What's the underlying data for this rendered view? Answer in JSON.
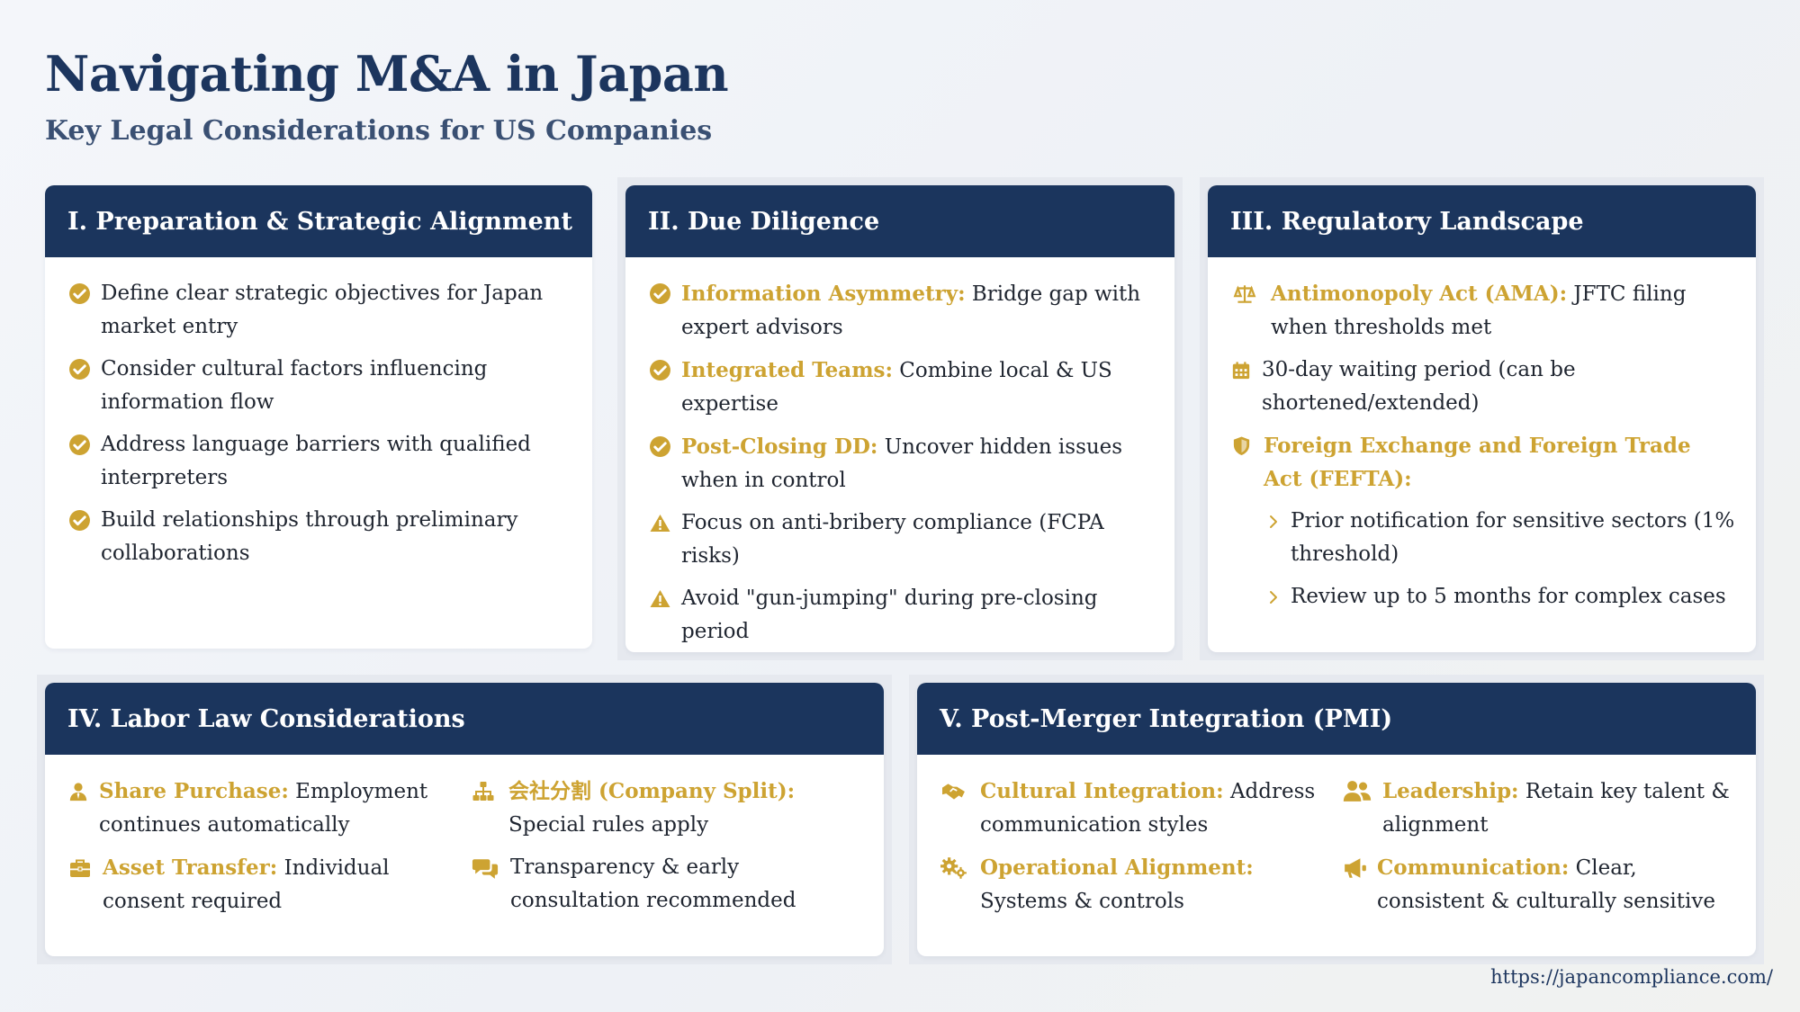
{
  "header": {
    "title": "Navigating M&A in Japan",
    "subtitle": "Key Legal Considerations for US Companies"
  },
  "colors": {
    "navy": "#1b355d",
    "gold": "#cda332",
    "text": "#1f2530"
  },
  "sections": {
    "preparation": {
      "title": "I. Preparation & Strategic Alignment",
      "items": [
        {
          "icon": "check-circle-icon",
          "text": "Define clear strategic objectives for Japan market entry"
        },
        {
          "icon": "check-circle-icon",
          "text": "Consider cultural factors influencing information flow"
        },
        {
          "icon": "check-circle-icon",
          "text": "Address language barriers with qualified interpreters"
        },
        {
          "icon": "check-circle-icon",
          "text": "Build relationships through preliminary collaborations"
        }
      ]
    },
    "due_diligence": {
      "title": "II. Due Diligence",
      "items": [
        {
          "icon": "check-circle-icon",
          "label": "Information Asymmetry:",
          "text": " Bridge gap with expert advisors"
        },
        {
          "icon": "check-circle-icon",
          "label": "Integrated Teams:",
          "text": " Combine local & US expertise"
        },
        {
          "icon": "check-circle-icon",
          "label": "Post-Closing DD:",
          "text": " Uncover hidden issues when in control"
        },
        {
          "icon": "warning-icon",
          "text": "Focus on anti-bribery compliance (FCPA risks)"
        },
        {
          "icon": "warning-icon",
          "text": "Avoid \"gun-jumping\" during pre-closing period"
        }
      ]
    },
    "regulatory": {
      "title": "III. Regulatory Landscape",
      "items": [
        {
          "icon": "scale-icon",
          "label": "Antimonopoly Act (AMA):",
          "text": " JFTC filing when thresholds met"
        },
        {
          "icon": "calendar-icon",
          "text": "30-day waiting period (can be shortened/extended)"
        },
        {
          "icon": "shield-icon",
          "label": "Foreign Exchange and Foreign Trade Act (FEFTA):"
        }
      ],
      "sub_items": [
        {
          "icon": "chevron-right-icon",
          "text": "Prior notification for sensitive sectors (1% threshold)"
        },
        {
          "icon": "chevron-right-icon",
          "text": "Review up to 5 months for complex cases"
        }
      ]
    },
    "labor": {
      "title": "IV. Labor Law Considerations",
      "items": [
        {
          "icon": "user-tie-icon",
          "label": "Share Purchase:",
          "text": " Employment continues automatically"
        },
        {
          "icon": "sitemap-icon",
          "label": "会社分割 (Company Split):",
          "text": " Special rules apply"
        },
        {
          "icon": "briefcase-icon",
          "label": "Asset Transfer:",
          "text": " Individual consent required"
        },
        {
          "icon": "comments-icon",
          "text": "Transparency & early consultation recommended"
        }
      ]
    },
    "pmi": {
      "title": "V. Post-Merger Integration (PMI)",
      "items": [
        {
          "icon": "handshake-icon",
          "label": "Cultural Integration:",
          "text": " Address communication styles"
        },
        {
          "icon": "users-icon",
          "label": "Leadership:",
          "text": " Retain key talent & alignment"
        },
        {
          "icon": "cogs-icon",
          "label": "Operational Alignment:",
          "text": " Systems & controls"
        },
        {
          "icon": "megaphone-icon",
          "label": "Communication:",
          "text": " Clear, consistent & culturally sensitive"
        }
      ]
    }
  },
  "footer": {
    "url": "https://japancompliance.com/"
  }
}
